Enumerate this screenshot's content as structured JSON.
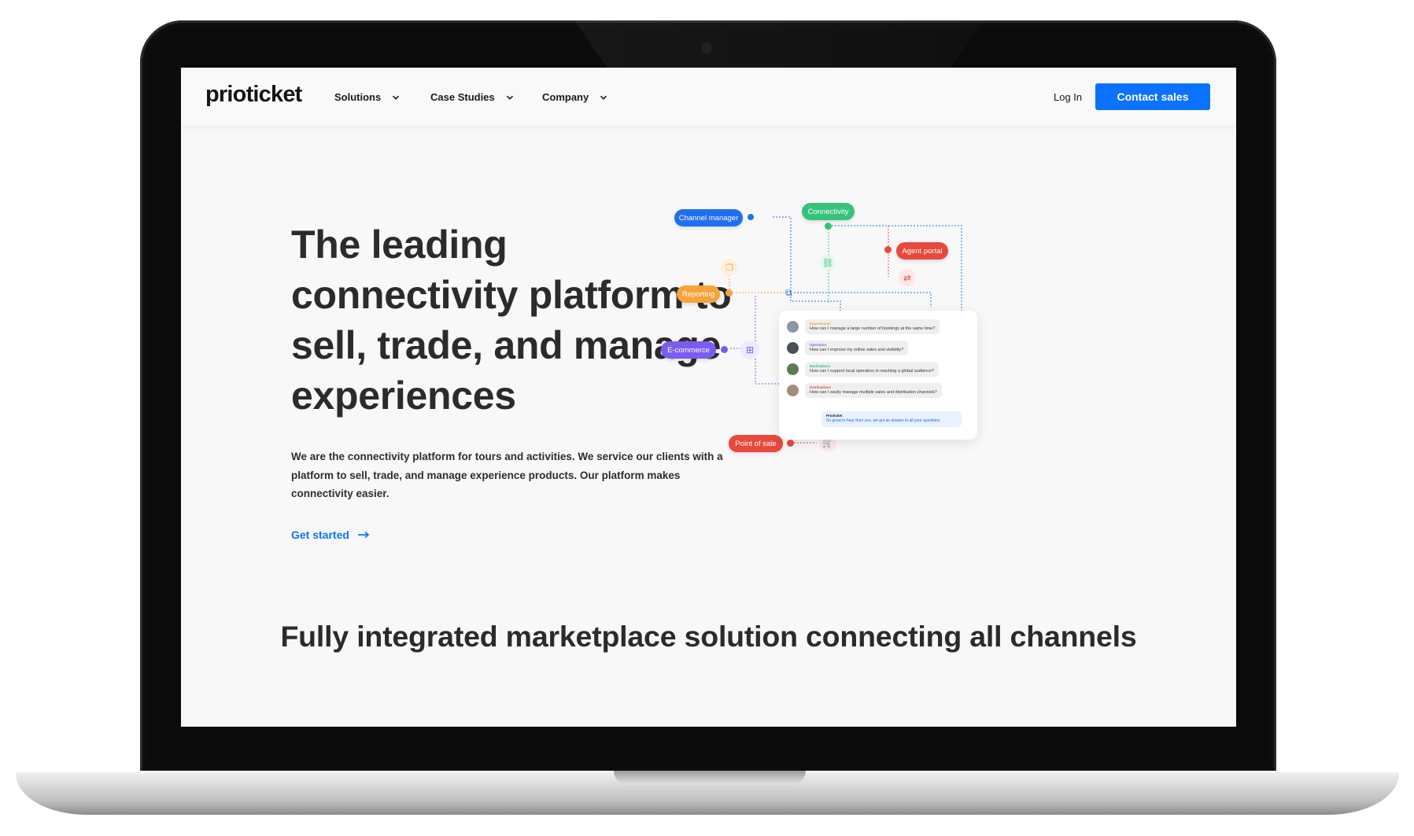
{
  "nav": {
    "logo": "prioticket",
    "items": [
      "Solutions",
      "Case Studies",
      "Company"
    ],
    "login": "Log In",
    "cta": "Contact sales"
  },
  "hero": {
    "headline": "The leading connectivity platform to sell, trade, and manage experiences",
    "body": "We are the connectivity platform for tours and activities. We service our clients with a platform to sell, trade, and manage experience products. Our platform makes connectivity easier.",
    "link": "Get started"
  },
  "diagram": {
    "nodes": [
      "Channel manager",
      "Connectivity",
      "Agent portal",
      "Reporting",
      "E-commerce",
      "Point of sale"
    ],
    "colors": {
      "channel_manager": "#1f6ff0",
      "connectivity": "#35c37c",
      "agent_portal": "#e8493d",
      "reporting": "#f7a23b",
      "ecommerce": "#7b5cf0",
      "point_of_sale": "#e8493d"
    },
    "chat": [
      {
        "tag": "Experiences",
        "tag_color": "#f7a23b",
        "text": "How can I manage a large number of bookings at the same time?"
      },
      {
        "tag": "Operators",
        "tag_color": "#7b5cf0",
        "text": "How can I improve my online sales and visibility?"
      },
      {
        "tag": "Marketplace",
        "tag_color": "#35c37c",
        "text": "How can I support local operators in reaching a global audience?"
      },
      {
        "tag": "Destinations",
        "tag_color": "#e8493d",
        "text": "How can I easily manage multiple sales and distribution channels?"
      }
    ],
    "reply": {
      "tag": "Prioticket",
      "text": "So great to hear from you, we got an answer to all your questions"
    }
  },
  "subhead": "Fully integrated marketplace solution connecting all channels",
  "colors": {
    "accent": "#0b72ff",
    "text": "#2b2b2b",
    "background": "#f8f8f8"
  }
}
